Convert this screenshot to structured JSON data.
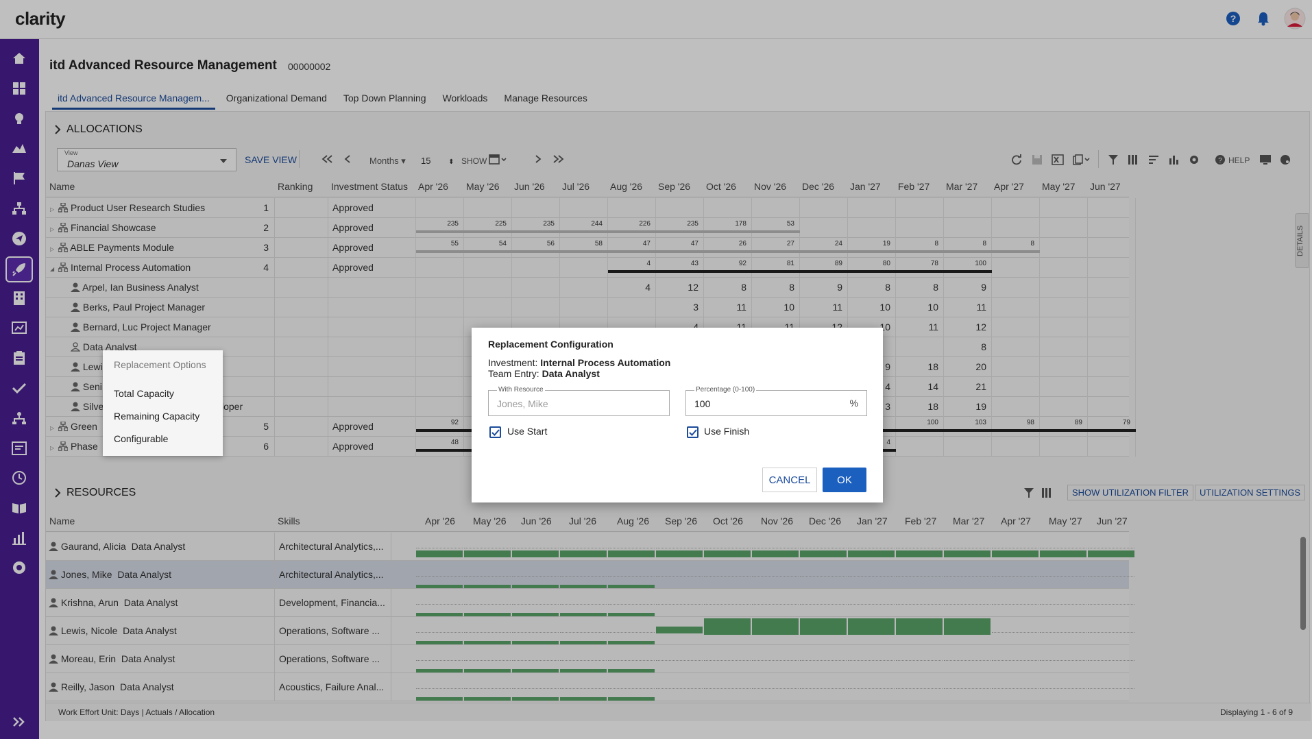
{
  "app": {
    "logo": "clarity"
  },
  "page": {
    "title": "itd Advanced Resource Management",
    "code": "00000002"
  },
  "tabs": [
    "itd Advanced Resource Managem...",
    "Organizational Demand",
    "Top Down Planning",
    "Workloads",
    "Manage Resources"
  ],
  "allocations": {
    "section_title": "ALLOCATIONS",
    "view_label": "View",
    "view_value": "Danas View",
    "save_view": "SAVE VIEW",
    "period_unit": "Months",
    "period_count": "15",
    "show_label": "SHOW",
    "help_label": "HELP",
    "details_label": "DETAILS",
    "columns": {
      "name": "Name",
      "ranking": "Ranking",
      "status": "Investment Status"
    },
    "months": [
      "Apr '26",
      "May '26",
      "Jun '26",
      "Jul '26",
      "Aug '26",
      "Sep '26",
      "Oct '26",
      "Nov '26",
      "Dec '26",
      "Jan '27",
      "Feb '27",
      "Mar '27",
      "Apr '27",
      "May '27",
      "Jun '27"
    ],
    "rows": [
      {
        "name": "Product User Research Studies",
        "ranking": "1",
        "status": "Approved"
      },
      {
        "name": "Financial Showcase",
        "ranking": "2",
        "status": "Approved"
      },
      {
        "name": "ABLE Payments Module",
        "ranking": "3",
        "status": "Approved"
      },
      {
        "name": "Internal Process Automation",
        "ranking": "4",
        "status": "Approved"
      },
      {
        "name": "Arpel, Ian Business Analyst"
      },
      {
        "name": "Berks, Paul Project Manager"
      },
      {
        "name": "Bernard, Luc Project Manager"
      },
      {
        "name": "Data Analyst"
      },
      {
        "name": "Lewi"
      },
      {
        "name": "Seni"
      },
      {
        "name": "Silve",
        "suffix": "loper"
      },
      {
        "name": "Green",
        "ranking": "5",
        "status": "Approved"
      },
      {
        "name": "Phase",
        "ranking": "6",
        "status": "Approved"
      }
    ],
    "financial_values": [
      "235",
      "225",
      "235",
      "244",
      "226",
      "235",
      "178",
      "53"
    ],
    "able_values": [
      "55",
      "54",
      "56",
      "58",
      "47",
      "47",
      "26",
      "27",
      "24",
      "19",
      "8",
      "8",
      "8"
    ],
    "ipa_values": [
      "4",
      "43",
      "92",
      "81",
      "89",
      "80",
      "78",
      "100"
    ],
    "arpel_values": [
      "4",
      "12",
      "8",
      "8",
      "9",
      "8",
      "8",
      "9"
    ],
    "berks_values": [
      "3",
      "11",
      "10",
      "11",
      "10",
      "10",
      "11"
    ],
    "bernard_values": [
      "4",
      "11",
      "11",
      "12",
      "10",
      "11",
      "12"
    ],
    "data_analyst_values": [
      "8"
    ],
    "lewi_values": [
      "9",
      "18",
      "20"
    ],
    "seni_values": [
      "4",
      "14",
      "21"
    ],
    "silve_values": [
      "3",
      "18",
      "19"
    ],
    "green_values": [
      "92",
      "100",
      "103",
      "98",
      "89",
      "79"
    ],
    "phase_values": [
      "48",
      "4"
    ]
  },
  "context_menu": {
    "title": "Replacement Options",
    "items": [
      "Total Capacity",
      "Remaining Capacity",
      "Configurable"
    ]
  },
  "dialog": {
    "title": "Replacement Configuration",
    "investment_label": "Investment:",
    "investment_value": "Internal Process Automation",
    "team_label": "Team Entry:",
    "team_value": "Data Analyst",
    "with_resource_label": "With Resource",
    "with_resource_placeholder": "Jones, Mike",
    "percentage_label": "Percentage (0-100)",
    "percentage_value": "100",
    "percent_sign": "%",
    "use_start": "Use Start",
    "use_finish": "Use Finish",
    "cancel": "CANCEL",
    "ok": "OK"
  },
  "resources": {
    "section_title": "RESOURCES",
    "show_filter": "SHOW UTILIZATION FILTER",
    "util_settings": "UTILIZATION SETTINGS",
    "columns": {
      "name": "Name",
      "skills": "Skills"
    },
    "rows": [
      {
        "name": "Gaurand, Alicia",
        "role": "Data Analyst",
        "skills": "Architectural Analytics,..."
      },
      {
        "name": "Jones, Mike",
        "role": "Data Analyst",
        "skills": "Architectural Analytics,..."
      },
      {
        "name": "Krishna, Arun",
        "role": "Data Analyst",
        "skills": "Development, Financia..."
      },
      {
        "name": "Lewis, Nicole",
        "role": "Data Analyst",
        "skills": "Operations, Software ..."
      },
      {
        "name": "Moreau, Erin",
        "role": "Data Analyst",
        "skills": "Operations, Software ..."
      },
      {
        "name": "Reilly, Jason",
        "role": "Data Analyst",
        "skills": "Acoustics, Failure Anal..."
      }
    ]
  },
  "footer": {
    "left": "Work Effort Unit: Days | Actuals / Allocation",
    "right": "Displaying 1 - 6 of 9"
  },
  "colors": {
    "sidebar": "#4a1e93",
    "accent": "#1b4b9b",
    "bar": "#5aa469"
  }
}
